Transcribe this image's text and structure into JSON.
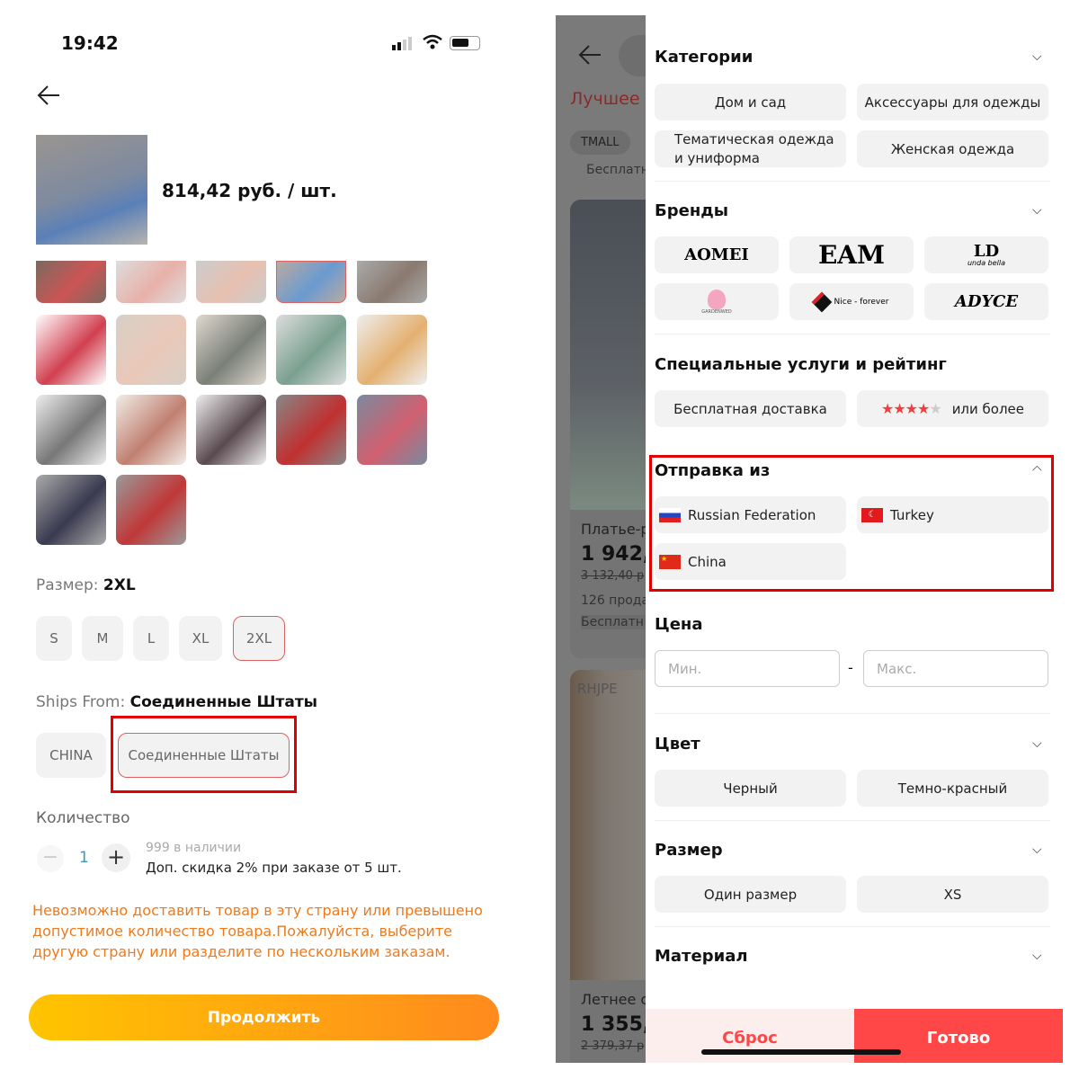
{
  "status_bar": {
    "time": "19:42"
  },
  "product": {
    "price": "814,42 руб. / шт.",
    "size_label": "Размер: ",
    "size_value": "2XL",
    "sizes": [
      "S",
      "M",
      "L",
      "XL",
      "2XL"
    ],
    "selected_size": "2XL",
    "ships_label": "Ships From: ",
    "ships_value": "Соединенные Штаты",
    "ship_options": [
      "CHINA",
      "Соединенные Штаты"
    ],
    "quantity_label": "Количество",
    "quantity": "1",
    "stock": "999 в наличии",
    "discount": "Доп. скидка 2% при заказе от 5 шт.",
    "error": "Невозможно доставить товар в эту страну или превышено допустимое количество товара.Пожалуйста, выберите другую страну или разделите по нескольким заказам.",
    "continue": "Продолжить"
  },
  "background_list": {
    "heading": "Лучшее с",
    "tmall": "TMALL",
    "free": "Бесплатн",
    "item1_title": "Платье-р",
    "item1_price": "1 942,(",
    "item1_old": "3 132,40 р",
    "item1_sold": "126 прода",
    "item1_ship": "Бесплатн",
    "item2_brand": "RHJPE",
    "item2_title": "Летнее с",
    "item2_price": "1 355,7",
    "item2_old": "2 379,37 р"
  },
  "filters": {
    "categories": {
      "title": "Категории",
      "items": [
        "Дом и сад",
        "Аксессуары для одежды",
        "Тематическая одежда и униформа",
        "Женская одежда"
      ]
    },
    "brands": {
      "title": "Бренды",
      "items": [
        "AOMEI",
        "EAM",
        "LD",
        "GARDENWED",
        "Nice - forever",
        "ADYCE"
      ],
      "sub": {
        "LD": "unda bella"
      }
    },
    "services": {
      "title": "Специальные услуги и рейтинг",
      "free_shipping": "Бесплатная доставка",
      "rating_suffix": "или более",
      "stars": 4
    },
    "ship_from": {
      "title": "Отправка из",
      "items": [
        "Russian Federation",
        "Turkey",
        "China"
      ]
    },
    "price": {
      "title": "Цена",
      "min_placeholder": "Мин.",
      "max_placeholder": "Макс.",
      "dash": "-"
    },
    "color": {
      "title": "Цвет",
      "items": [
        "Черный",
        "Темно-красный"
      ]
    },
    "size": {
      "title": "Размер",
      "items": [
        "Один размер",
        "XS"
      ]
    },
    "material": {
      "title": "Материал"
    },
    "reset": "Сброс",
    "done": "Готово"
  },
  "colors": {
    "accent": "#ff4747",
    "highlight": "#e00000",
    "orange": "#f07a1a"
  }
}
